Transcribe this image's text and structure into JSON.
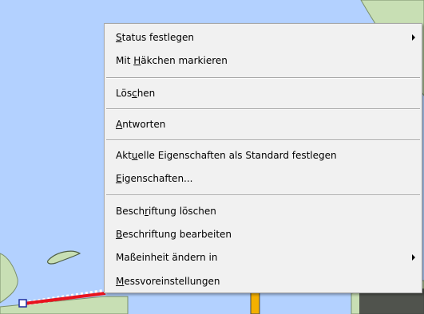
{
  "map": {
    "colors": {
      "water": "#b3d1ff",
      "land": "#c8dfb4",
      "land_edge": "#7a8f6a",
      "route": "#e8141e",
      "road": "#f4b000",
      "road_edge": "#444444",
      "label_dark": "#3b3b3b"
    }
  },
  "menu": {
    "items": [
      {
        "name": "status-festlegen",
        "label": "Status festlegen",
        "mnemonic": "S",
        "submenu": true
      },
      {
        "name": "haekchen-markieren",
        "label": "Mit Häkchen markieren",
        "mnemonic": "H",
        "submenu": false
      },
      {
        "name": "loeschen",
        "label": "Löschen",
        "mnemonic": "c",
        "submenu": false
      },
      {
        "name": "antworten",
        "label": "Antworten",
        "mnemonic": "A",
        "submenu": false
      },
      {
        "name": "standard-festlegen",
        "label": "Aktuelle Eigenschaften als Standard festlegen",
        "mnemonic": "u",
        "submenu": false
      },
      {
        "name": "eigenschaften",
        "label": "Eigenschaften...",
        "mnemonic": "E",
        "submenu": false
      },
      {
        "name": "beschriftung-loeschen",
        "label": "Beschriftung löschen",
        "mnemonic": "r",
        "submenu": false
      },
      {
        "name": "beschriftung-bearbeiten",
        "label": "Beschriftung bearbeiten",
        "mnemonic": "B",
        "submenu": false
      },
      {
        "name": "masseinheit-aendern",
        "label": "Maßeinheit ändern in",
        "mnemonic": "",
        "submenu": true
      },
      {
        "name": "messvoreinstellungen",
        "label": "Messvoreinstellungen",
        "mnemonic": "M",
        "submenu": false
      }
    ]
  }
}
